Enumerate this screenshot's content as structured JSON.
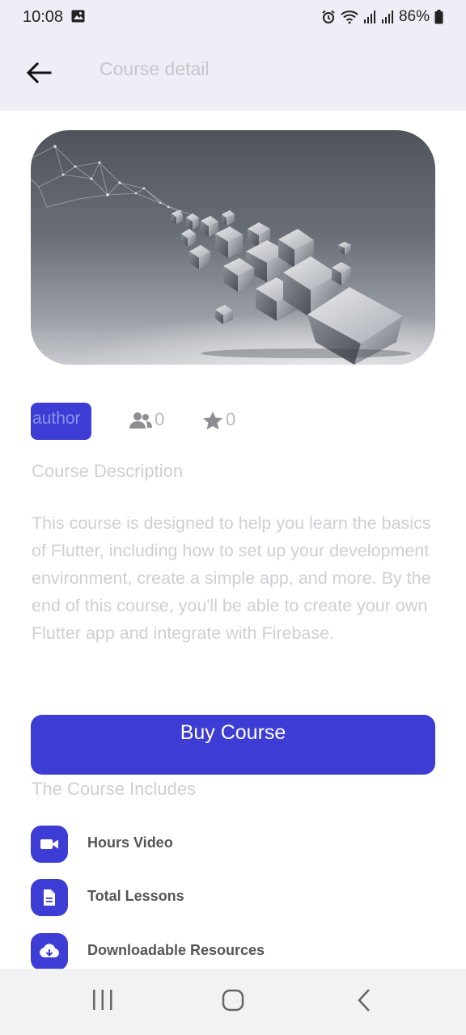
{
  "status_bar": {
    "time": "10:08",
    "battery": "86%",
    "icons": [
      "gallery-icon",
      "alarm-icon",
      "wifi-icon",
      "signal-icon",
      "signal-icon",
      "battery-icon"
    ]
  },
  "app_bar": {
    "title": "Course detail",
    "back_icon": "arrow-left-icon"
  },
  "course": {
    "author_label": "author",
    "students_count": "0",
    "rating": "0",
    "description_title": "Course Description",
    "description": "This course is designed to help you learn the basics of Flutter, including how to set up your development environment, create a simple app, and more. By the end of this course, you'll be able to create your own Flutter app and integrate with Firebase.",
    "buy_label": "Buy Course",
    "includes_title": "The Course Includes",
    "includes": [
      {
        "label": "Hours Video",
        "icon": "video-camera-icon"
      },
      {
        "label": "Total Lessons",
        "icon": "document-icon"
      },
      {
        "label": "Downloadable Resources",
        "icon": "cloud-download-icon"
      }
    ]
  },
  "colors": {
    "accent": "#3d3dd6",
    "app_bar_bg": "#efedf5",
    "muted_text": "#cfcfd4"
  }
}
